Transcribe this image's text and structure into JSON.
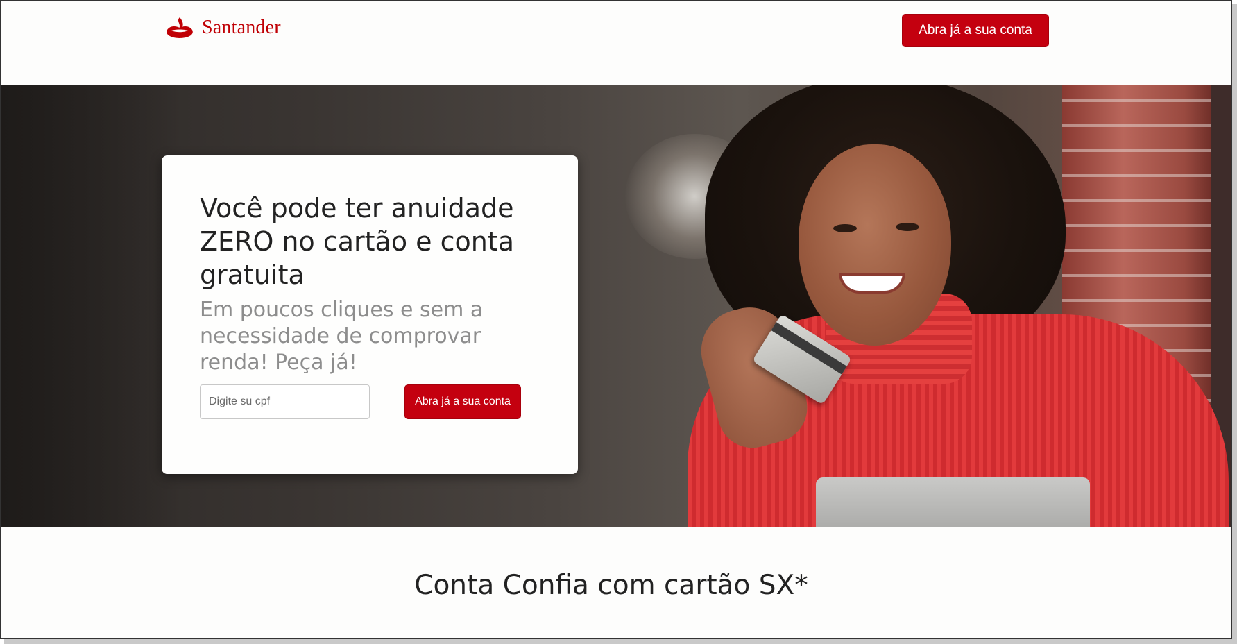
{
  "header": {
    "brand": "Santander",
    "cta_label": "Abra já a sua conta"
  },
  "hero": {
    "title": "Você pode ter anuidade ZERO no cartão e conta gratuita",
    "subtitle": "Em poucos cliques e sem a necessidade de comprovar renda! Peça já!",
    "cpf_placeholder": "Digite su cpf",
    "cpf_value": "",
    "cta_label": "Abra já a sua conta"
  },
  "section": {
    "title": "Conta Confia com cartão SX*"
  },
  "colors": {
    "brand_red": "#c4000f",
    "logo_red": "#c00005"
  },
  "icons": {
    "logo": "santander-flame-icon"
  }
}
